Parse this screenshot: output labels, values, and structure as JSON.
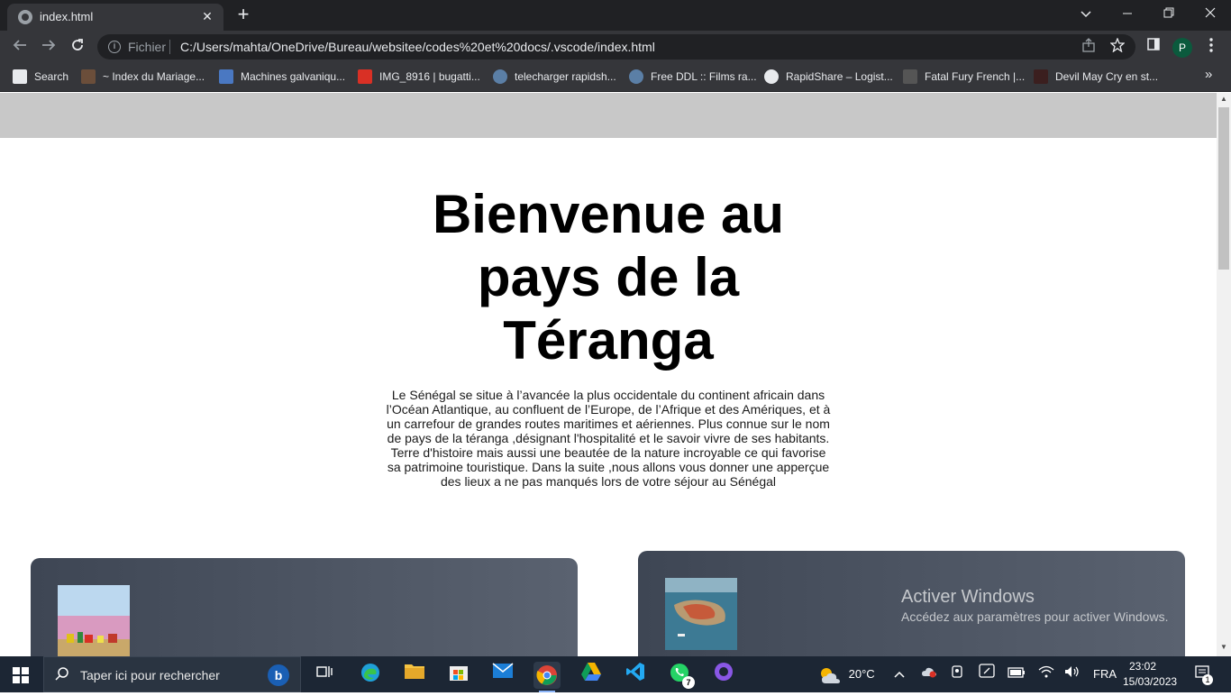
{
  "browser": {
    "tab_title": "index.html",
    "tab_close": "✕",
    "new_tab": "+",
    "scheme_label": "Fichier",
    "url": "C:/Users/mahta/OneDrive/Bureau/websitee/codes%20et%20docs/.vscode/index.html",
    "profile_initial": "P",
    "bookmarks": [
      {
        "label": "Search",
        "icon": "search-icon"
      },
      {
        "label": "~ Index du Mariage...",
        "icon": "bookmark-favicon"
      },
      {
        "label": "Machines galvaniqu...",
        "icon": "bookmark-favicon"
      },
      {
        "label": "IMG_8916 | bugatti...",
        "icon": "bookmark-favicon"
      },
      {
        "label": "telecharger rapidsh...",
        "icon": "bookmark-favicon"
      },
      {
        "label": "Free DDL :: Films ra...",
        "icon": "bookmark-favicon"
      },
      {
        "label": "RapidShare – Logist...",
        "icon": "bookmark-favicon"
      },
      {
        "label": "Fatal Fury French |...",
        "icon": "bookmark-favicon"
      },
      {
        "label": "Devil May Cry en st...",
        "icon": "bookmark-favicon"
      }
    ],
    "bookmarks_overflow": "»"
  },
  "page": {
    "title_line1": "Bienvenue au",
    "title_line2": "pays de la",
    "title_line3": "Téranga",
    "intro": "Le Sénégal se situe à l’avancée la plus occidentale du continent africain dans l’Océan Atlantique, au confluent de l’Europe, de l’Afrique et des Amériques, et à un carrefour de grandes routes maritimes et aériennes. Plus connue sur le nom de pays de la téranga ,désignant l'hospitalité et le savoir vivre de ses habitants. Terre d'histoire mais aussi une beautée de la nature incroyable ce qui favorise sa patrimoine touristique. Dans la suite ,nous allons vous donner une apperçue des lieux a ne pas manqués lors de votre séjour au Sénégal"
  },
  "windows_activation": {
    "title": "Activer Windows",
    "subtitle": "Accédez aux paramètres pour activer Windows."
  },
  "taskbar": {
    "search_placeholder": "Taper ici pour rechercher",
    "weather": "20°C",
    "language": "FRA",
    "time": "23:02",
    "date": "15/03/2023",
    "whatsapp_badge": "7",
    "notification_badge": "1"
  },
  "colors": {
    "chrome_dark": "#202124",
    "chrome_toolbar": "#35363a",
    "page_header": "#c8c8c8",
    "card_bg": "#4a5260",
    "taskbar": "#1c2634"
  }
}
